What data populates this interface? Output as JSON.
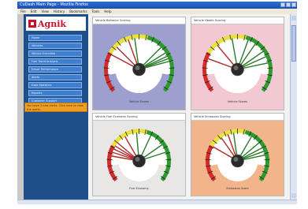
{
  "window": {
    "title": "CuDash Main Page - Mozilla Firefox"
  },
  "menu": [
    "File",
    "Edit",
    "View",
    "History",
    "Bookmarks",
    "Tools",
    "Help"
  ],
  "brand": {
    "name": "Agnik"
  },
  "nav": [
    {
      "label": "Home"
    },
    {
      "label": "Vehicles"
    },
    {
      "label": "Vehicle Overview"
    },
    {
      "label": "Fuel Trend Analysis"
    },
    {
      "label": "Driver Performance"
    },
    {
      "label": "Alerts"
    },
    {
      "label": "Data Statistics"
    },
    {
      "label": "Reports"
    },
    {
      "label": "Customer Support"
    },
    {
      "label": "Logout"
    }
  ],
  "alert": {
    "text": "You have 3 new alerts. Click here to view the alerts."
  },
  "panels": [
    {
      "title": "Vehicle Behavior Scoring",
      "bottom_label": "Vehicle Scores",
      "bg": "#9da0cf",
      "needles": [
        [
          -62,
          "#b02828"
        ],
        [
          -45,
          "#b02828"
        ],
        [
          -20,
          "#b02828"
        ],
        [
          -8,
          "#2a7a2a"
        ],
        [
          45,
          "#2a7a2a"
        ],
        [
          58,
          "#2a7a2a"
        ],
        [
          65,
          "#2a7a2a"
        ],
        [
          70,
          "#2a7a2a"
        ],
        [
          75,
          "#2a7a2a"
        ]
      ]
    },
    {
      "title": "Vehicle Health Scoring",
      "bottom_label": "Vehicle Scores",
      "bg": "#f2c8d2",
      "needles": [
        [
          -70,
          "#b02828"
        ],
        [
          -40,
          "#b02828"
        ],
        [
          -10,
          "#2a7a2a"
        ],
        [
          20,
          "#2a7a2a"
        ],
        [
          35,
          "#2a7a2a"
        ],
        [
          55,
          "#2a7a2a"
        ],
        [
          66,
          "#2a7a2a"
        ],
        [
          78,
          "#2a7a2a"
        ]
      ]
    },
    {
      "title": "Vehicle Fuel Economy Scoring",
      "bottom_label": "Fuel Economy",
      "bg": "#e9e6e6",
      "needles": [
        [
          -80,
          "#b02828"
        ],
        [
          -72,
          "#b02828"
        ],
        [
          -65,
          "#b02828"
        ],
        [
          -58,
          "#b02828"
        ],
        [
          -50,
          "#b02828"
        ],
        [
          -30,
          "#b02828"
        ],
        [
          -5,
          "#2a7a2a"
        ],
        [
          25,
          "#2a7a2a"
        ],
        [
          55,
          "#2a7a2a"
        ],
        [
          72,
          "#2a7a2a"
        ]
      ]
    },
    {
      "title": "Vehicle Emissions Scoring",
      "bottom_label": "Emissions Score",
      "bg": "#f2b48a",
      "needles": [
        [
          -60,
          "#b02828"
        ],
        [
          -35,
          "#b02828"
        ],
        [
          -20,
          "#b02828"
        ],
        [
          -8,
          "#2a7a2a"
        ],
        [
          30,
          "#2a7a2a"
        ],
        [
          50,
          "#2a7a2a"
        ],
        [
          62,
          "#2a7a2a"
        ],
        [
          70,
          "#2a7a2a"
        ],
        [
          78,
          "#2a7a2a"
        ]
      ]
    }
  ]
}
